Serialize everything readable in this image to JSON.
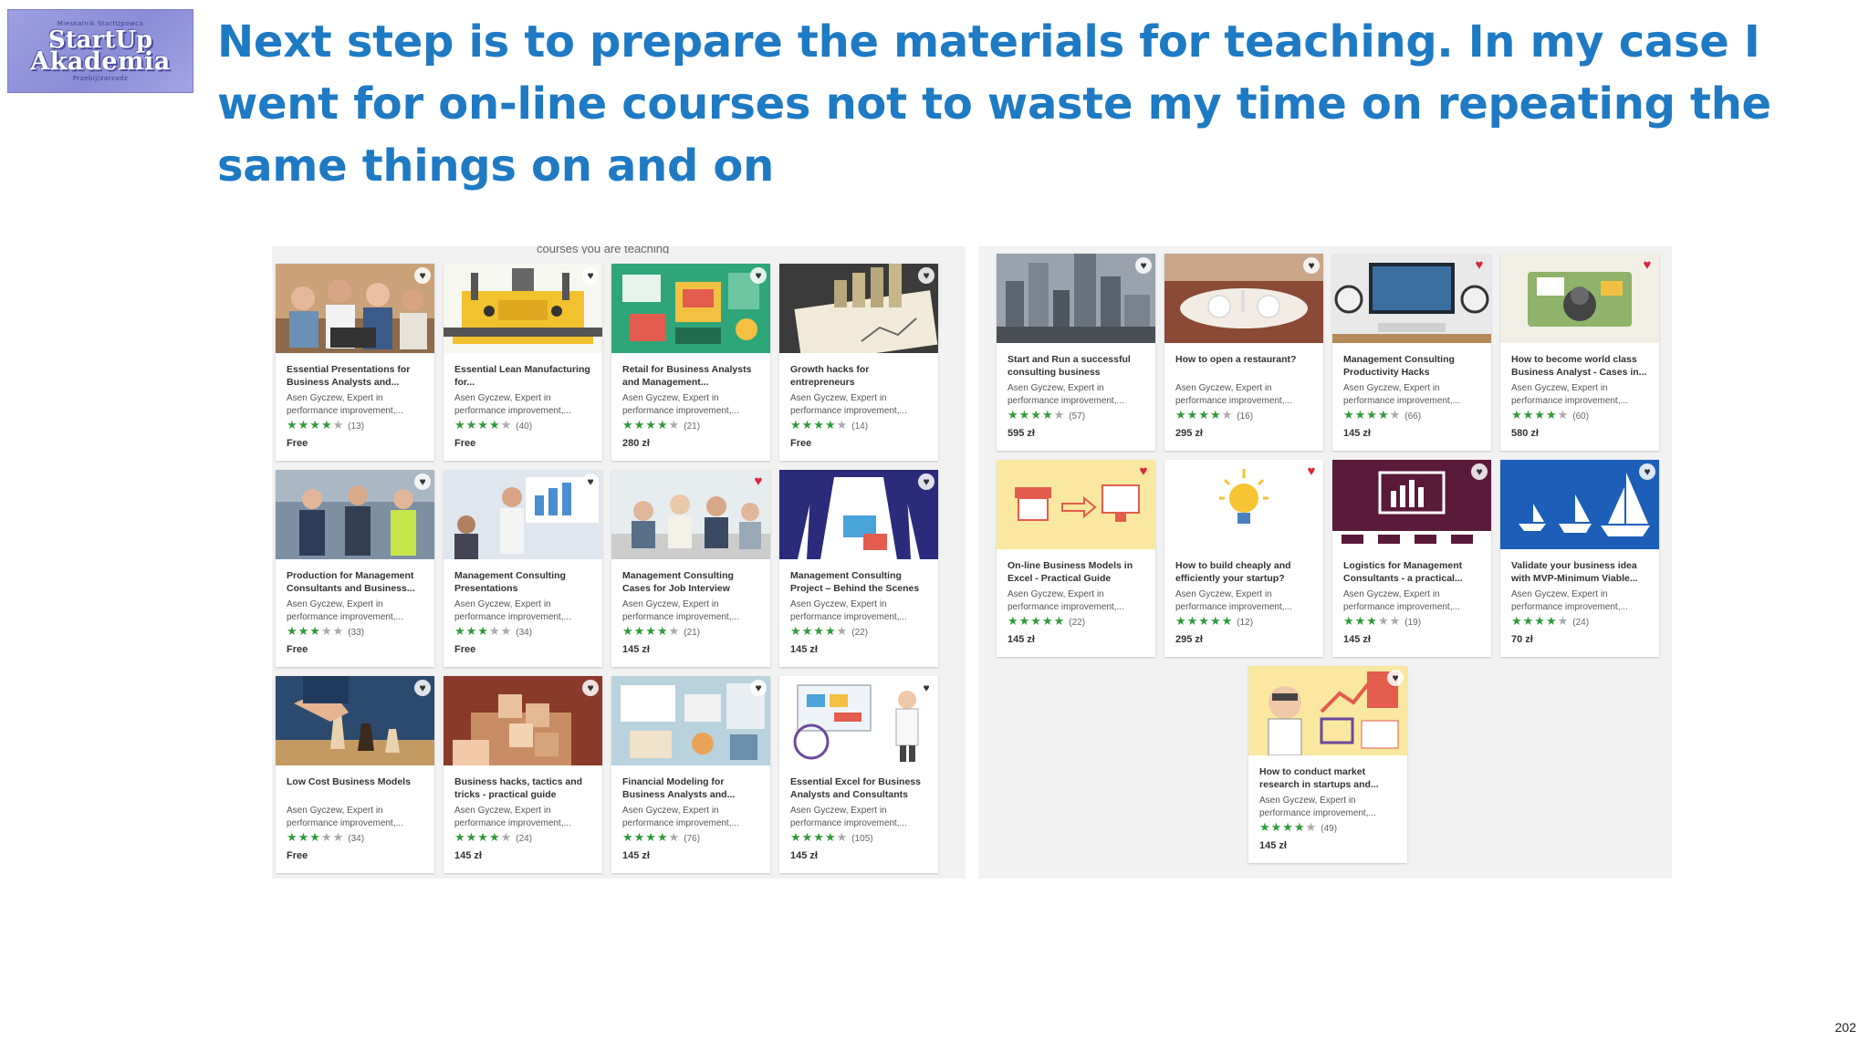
{
  "logo": {
    "top_text": "Mieskalnik StartUpowca",
    "line1": "StartUp",
    "line2": "Akademia",
    "bottom_text": "Przebij/zarzadz"
  },
  "title": "Next step is to prepare the materials for teaching. In my case I went for on-line courses not to waste my time on repeating the same things on and on",
  "page_number": "202",
  "left_panel": {
    "cut_text": "courses you are teaching",
    "courses": [
      {
        "title": "Essential Presentations for Business Analysts and...",
        "author": "Asen Gyczew, Expert in",
        "subtitle": "performance improvement,...",
        "stars_full": "★★★★",
        "stars_empty": "★",
        "count": "(13)",
        "price": "Free",
        "fav": "♥",
        "fav_active": false,
        "thumb": "people"
      },
      {
        "title": "Essential Lean Manufacturing for...",
        "author": "Asen Gyczew, Expert in",
        "subtitle": "performance improvement,...",
        "stars_full": "★★★★",
        "stars_empty": "★",
        "count": "(40)",
        "price": "Free",
        "fav": "♥",
        "fav_active": false,
        "thumb": "factory"
      },
      {
        "title": "Retail for Business Analysts and Management...",
        "author": "Asen Gyczew, Expert in",
        "subtitle": "performance improvement,...",
        "stars_full": "★★★★",
        "stars_empty": "★",
        "count": "(21)",
        "price": "280 zł",
        "fav": "♥",
        "fav_active": false,
        "thumb": "retail"
      },
      {
        "title": "Growth hacks for entrepreneurs",
        "author": "Asen Gyczew, Expert in",
        "subtitle": "performance improvement,...",
        "stars_full": "★★★★",
        "stars_empty": "★",
        "count": "(14)",
        "price": "Free",
        "fav": "♥",
        "fav_active": false,
        "thumb": "coins"
      },
      {
        "title": "Production for Management Consultants and Business...",
        "author": "Asen Gyczew, Expert in",
        "subtitle": "performance improvement,...",
        "stars_full": "★★★",
        "stars_empty": "★★",
        "count": "(33)",
        "price": "Free",
        "fav": "♥",
        "fav_active": false,
        "thumb": "workers"
      },
      {
        "title": "Management Consulting Presentations",
        "author": "Asen Gyczew, Expert in",
        "subtitle": "performance improvement,...",
        "stars_full": "★★★",
        "stars_empty": "★★",
        "count": "(34)",
        "price": "Free",
        "fav": "♥",
        "fav_active": false,
        "thumb": "presenter"
      },
      {
        "title": "Management Consulting Cases for Job Interview",
        "author": "Asen Gyczew, Expert in",
        "subtitle": "performance improvement,...",
        "stars_full": "★★★★",
        "stars_empty": "★",
        "count": "(21)",
        "price": "145 zł",
        "fav": "♥",
        "fav_active": true,
        "thumb": "meeting"
      },
      {
        "title": "Management Consulting Project – Behind the Scenes",
        "author": "Asen Gyczew, Expert in",
        "subtitle": "performance improvement,...",
        "stars_full": "★★★★",
        "stars_empty": "★",
        "count": "(22)",
        "price": "145 zł",
        "fav": "♥",
        "fav_active": false,
        "thumb": "curtain"
      },
      {
        "title": "Low Cost Business Models",
        "author": "Asen Gyczew, Expert in",
        "subtitle": "performance improvement,...",
        "stars_full": "★★★",
        "stars_empty": "★★",
        "count": "(34)",
        "price": "Free",
        "fav": "♥",
        "fav_active": false,
        "thumb": "chess"
      },
      {
        "title": "Business hacks, tactics and tricks - practical guide",
        "author": "Asen Gyczew, Expert in",
        "subtitle": "performance improvement,...",
        "stars_full": "★★★★",
        "stars_empty": "★",
        "count": "(24)",
        "price": "145 zł",
        "fav": "♥",
        "fav_active": false,
        "thumb": "blocks"
      },
      {
        "title": "Financial Modeling for Business Analysts and...",
        "author": "Asen Gyczew, Expert in",
        "subtitle": "performance improvement,...",
        "stars_full": "★★★★",
        "stars_empty": "★",
        "count": "(76)",
        "price": "145 zł",
        "fav": "♥",
        "fav_active": false,
        "thumb": "desk"
      },
      {
        "title": "Essential Excel for Business Analysts and Consultants",
        "author": "Asen Gyczew, Expert in",
        "subtitle": "performance improvement,...",
        "stars_full": "★★★★",
        "stars_empty": "★",
        "count": "(105)",
        "price": "145 zł",
        "fav": "♥",
        "fav_active": false,
        "thumb": "scientist"
      }
    ]
  },
  "right_panel": {
    "courses": [
      {
        "title": "Start and Run a successful consulting business",
        "author": "Asen Gyczew, Expert in",
        "subtitle": "performance improvement,...",
        "stars_full": "★★★★",
        "stars_empty": "★",
        "count": "(57)",
        "price": "595 zł",
        "fav": "♥",
        "fav_active": false,
        "thumb": "city"
      },
      {
        "title": "How to open a restaurant?",
        "author": "Asen Gyczew, Expert in",
        "subtitle": "performance improvement,...",
        "stars_full": "★★★★",
        "stars_empty": "★",
        "count": "(16)",
        "price": "295 zł",
        "fav": "♥",
        "fav_active": false,
        "thumb": "restaurant"
      },
      {
        "title": "Management Consulting Productivity Hacks",
        "author": "Asen Gyczew, Expert in",
        "subtitle": "performance improvement,...",
        "stars_full": "★★★★",
        "stars_empty": "★",
        "count": "(66)",
        "price": "145 zł",
        "fav": "♥",
        "fav_active": true,
        "thumb": "workspace"
      },
      {
        "title": "How to become world class Business Analyst - Cases in...",
        "author": "Asen Gyczew, Expert in",
        "subtitle": "performance improvement,...",
        "stars_full": "★★★★",
        "stars_empty": "★",
        "count": "(60)",
        "price": "580 zł",
        "fav": "♥",
        "fav_active": true,
        "thumb": "topdesk"
      },
      {
        "title": "On-line Business Models in Excel - Practical Guide",
        "author": "Asen Gyczew, Expert in",
        "subtitle": "performance improvement,...",
        "stars_full": "★★★★★",
        "stars_empty": "",
        "count": "(22)",
        "price": "145 zł",
        "fav": "♥",
        "fav_active": true,
        "thumb": "shop"
      },
      {
        "title": "How to build cheaply and efficiently your startup?",
        "author": "Asen Gyczew, Expert in",
        "subtitle": "performance improvement,...",
        "stars_full": "★★★★★",
        "stars_empty": "",
        "count": "(12)",
        "price": "295 zł",
        "fav": "♥",
        "fav_active": true,
        "thumb": "bulb"
      },
      {
        "title": "Logistics for Management Consultants - a practical...",
        "author": "Asen Gyczew, Expert in",
        "subtitle": "performance improvement,...",
        "stars_full": "★★★",
        "stars_empty": "★★",
        "count": "(19)",
        "price": "145 zł",
        "fav": "♥",
        "fav_active": false,
        "thumb": "logistics"
      },
      {
        "title": "Validate your business idea with MVP-Minimum Viable...",
        "author": "Asen Gyczew, Expert in",
        "subtitle": "performance improvement,...",
        "stars_full": "★★★★",
        "stars_empty": "★",
        "count": "(24)",
        "price": "70 zł",
        "fav": "♥",
        "fav_active": false,
        "thumb": "boats"
      },
      {
        "title": "How to conduct market research in startups and...",
        "author": "Asen Gyczew, Expert in",
        "subtitle": "performance improvement,...",
        "stars_full": "★★★★",
        "stars_empty": "★",
        "count": "(49)",
        "price": "145 zł",
        "fav": "♥",
        "fav_active": false,
        "thumb": "research"
      }
    ]
  },
  "colors": {
    "title": "#1f7ac4",
    "star": "#2f9a3a",
    "heart_active": "#d8283f",
    "panel_bg": "#f2f2f2"
  }
}
